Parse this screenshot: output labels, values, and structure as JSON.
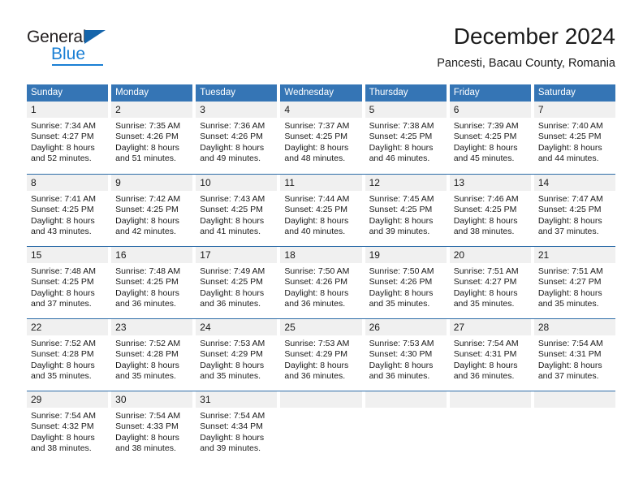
{
  "brand": {
    "name_part1": "General",
    "name_part2": "Blue",
    "flag_icon": "blue-triangle-flag-icon",
    "colors": {
      "dark": "#231f20",
      "blue": "#1a7fd4"
    }
  },
  "header": {
    "title": "December 2024",
    "subtitle": "Pancesti, Bacau County, Romania"
  },
  "theme": {
    "header_blue": "#3575b5",
    "row_divider_blue": "#2d6ca8",
    "day_band_gray": "#f0f0f0",
    "text": "#1a1a1a"
  },
  "calendar": {
    "weekdays": [
      "Sunday",
      "Monday",
      "Tuesday",
      "Wednesday",
      "Thursday",
      "Friday",
      "Saturday"
    ],
    "weeks": [
      [
        {
          "day": "1",
          "sunrise": "Sunrise: 7:34 AM",
          "sunset": "Sunset: 4:27 PM",
          "daylight1": "Daylight: 8 hours",
          "daylight2": "and 52 minutes."
        },
        {
          "day": "2",
          "sunrise": "Sunrise: 7:35 AM",
          "sunset": "Sunset: 4:26 PM",
          "daylight1": "Daylight: 8 hours",
          "daylight2": "and 51 minutes."
        },
        {
          "day": "3",
          "sunrise": "Sunrise: 7:36 AM",
          "sunset": "Sunset: 4:26 PM",
          "daylight1": "Daylight: 8 hours",
          "daylight2": "and 49 minutes."
        },
        {
          "day": "4",
          "sunrise": "Sunrise: 7:37 AM",
          "sunset": "Sunset: 4:25 PM",
          "daylight1": "Daylight: 8 hours",
          "daylight2": "and 48 minutes."
        },
        {
          "day": "5",
          "sunrise": "Sunrise: 7:38 AM",
          "sunset": "Sunset: 4:25 PM",
          "daylight1": "Daylight: 8 hours",
          "daylight2": "and 46 minutes."
        },
        {
          "day": "6",
          "sunrise": "Sunrise: 7:39 AM",
          "sunset": "Sunset: 4:25 PM",
          "daylight1": "Daylight: 8 hours",
          "daylight2": "and 45 minutes."
        },
        {
          "day": "7",
          "sunrise": "Sunrise: 7:40 AM",
          "sunset": "Sunset: 4:25 PM",
          "daylight1": "Daylight: 8 hours",
          "daylight2": "and 44 minutes."
        }
      ],
      [
        {
          "day": "8",
          "sunrise": "Sunrise: 7:41 AM",
          "sunset": "Sunset: 4:25 PM",
          "daylight1": "Daylight: 8 hours",
          "daylight2": "and 43 minutes."
        },
        {
          "day": "9",
          "sunrise": "Sunrise: 7:42 AM",
          "sunset": "Sunset: 4:25 PM",
          "daylight1": "Daylight: 8 hours",
          "daylight2": "and 42 minutes."
        },
        {
          "day": "10",
          "sunrise": "Sunrise: 7:43 AM",
          "sunset": "Sunset: 4:25 PM",
          "daylight1": "Daylight: 8 hours",
          "daylight2": "and 41 minutes."
        },
        {
          "day": "11",
          "sunrise": "Sunrise: 7:44 AM",
          "sunset": "Sunset: 4:25 PM",
          "daylight1": "Daylight: 8 hours",
          "daylight2": "and 40 minutes."
        },
        {
          "day": "12",
          "sunrise": "Sunrise: 7:45 AM",
          "sunset": "Sunset: 4:25 PM",
          "daylight1": "Daylight: 8 hours",
          "daylight2": "and 39 minutes."
        },
        {
          "day": "13",
          "sunrise": "Sunrise: 7:46 AM",
          "sunset": "Sunset: 4:25 PM",
          "daylight1": "Daylight: 8 hours",
          "daylight2": "and 38 minutes."
        },
        {
          "day": "14",
          "sunrise": "Sunrise: 7:47 AM",
          "sunset": "Sunset: 4:25 PM",
          "daylight1": "Daylight: 8 hours",
          "daylight2": "and 37 minutes."
        }
      ],
      [
        {
          "day": "15",
          "sunrise": "Sunrise: 7:48 AM",
          "sunset": "Sunset: 4:25 PM",
          "daylight1": "Daylight: 8 hours",
          "daylight2": "and 37 minutes."
        },
        {
          "day": "16",
          "sunrise": "Sunrise: 7:48 AM",
          "sunset": "Sunset: 4:25 PM",
          "daylight1": "Daylight: 8 hours",
          "daylight2": "and 36 minutes."
        },
        {
          "day": "17",
          "sunrise": "Sunrise: 7:49 AM",
          "sunset": "Sunset: 4:25 PM",
          "daylight1": "Daylight: 8 hours",
          "daylight2": "and 36 minutes."
        },
        {
          "day": "18",
          "sunrise": "Sunrise: 7:50 AM",
          "sunset": "Sunset: 4:26 PM",
          "daylight1": "Daylight: 8 hours",
          "daylight2": "and 36 minutes."
        },
        {
          "day": "19",
          "sunrise": "Sunrise: 7:50 AM",
          "sunset": "Sunset: 4:26 PM",
          "daylight1": "Daylight: 8 hours",
          "daylight2": "and 35 minutes."
        },
        {
          "day": "20",
          "sunrise": "Sunrise: 7:51 AM",
          "sunset": "Sunset: 4:27 PM",
          "daylight1": "Daylight: 8 hours",
          "daylight2": "and 35 minutes."
        },
        {
          "day": "21",
          "sunrise": "Sunrise: 7:51 AM",
          "sunset": "Sunset: 4:27 PM",
          "daylight1": "Daylight: 8 hours",
          "daylight2": "and 35 minutes."
        }
      ],
      [
        {
          "day": "22",
          "sunrise": "Sunrise: 7:52 AM",
          "sunset": "Sunset: 4:28 PM",
          "daylight1": "Daylight: 8 hours",
          "daylight2": "and 35 minutes."
        },
        {
          "day": "23",
          "sunrise": "Sunrise: 7:52 AM",
          "sunset": "Sunset: 4:28 PM",
          "daylight1": "Daylight: 8 hours",
          "daylight2": "and 35 minutes."
        },
        {
          "day": "24",
          "sunrise": "Sunrise: 7:53 AM",
          "sunset": "Sunset: 4:29 PM",
          "daylight1": "Daylight: 8 hours",
          "daylight2": "and 35 minutes."
        },
        {
          "day": "25",
          "sunrise": "Sunrise: 7:53 AM",
          "sunset": "Sunset: 4:29 PM",
          "daylight1": "Daylight: 8 hours",
          "daylight2": "and 36 minutes."
        },
        {
          "day": "26",
          "sunrise": "Sunrise: 7:53 AM",
          "sunset": "Sunset: 4:30 PM",
          "daylight1": "Daylight: 8 hours",
          "daylight2": "and 36 minutes."
        },
        {
          "day": "27",
          "sunrise": "Sunrise: 7:54 AM",
          "sunset": "Sunset: 4:31 PM",
          "daylight1": "Daylight: 8 hours",
          "daylight2": "and 36 minutes."
        },
        {
          "day": "28",
          "sunrise": "Sunrise: 7:54 AM",
          "sunset": "Sunset: 4:31 PM",
          "daylight1": "Daylight: 8 hours",
          "daylight2": "and 37 minutes."
        }
      ],
      [
        {
          "day": "29",
          "sunrise": "Sunrise: 7:54 AM",
          "sunset": "Sunset: 4:32 PM",
          "daylight1": "Daylight: 8 hours",
          "daylight2": "and 38 minutes."
        },
        {
          "day": "30",
          "sunrise": "Sunrise: 7:54 AM",
          "sunset": "Sunset: 4:33 PM",
          "daylight1": "Daylight: 8 hours",
          "daylight2": "and 38 minutes."
        },
        {
          "day": "31",
          "sunrise": "Sunrise: 7:54 AM",
          "sunset": "Sunset: 4:34 PM",
          "daylight1": "Daylight: 8 hours",
          "daylight2": "and 39 minutes."
        },
        {
          "day": "",
          "sunrise": "",
          "sunset": "",
          "daylight1": "",
          "daylight2": ""
        },
        {
          "day": "",
          "sunrise": "",
          "sunset": "",
          "daylight1": "",
          "daylight2": ""
        },
        {
          "day": "",
          "sunrise": "",
          "sunset": "",
          "daylight1": "",
          "daylight2": ""
        },
        {
          "day": "",
          "sunrise": "",
          "sunset": "",
          "daylight1": "",
          "daylight2": ""
        }
      ]
    ]
  }
}
